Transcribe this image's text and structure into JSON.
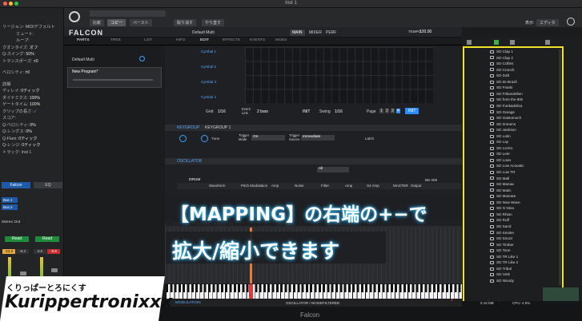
{
  "window": {
    "title": "Inst 1"
  },
  "toolbar": {
    "compare": "比較",
    "copy": "コピー",
    "paste": "ペースト",
    "undo": "取り消す",
    "redo": "やり直す",
    "view": "表示:",
    "view_value": "エディタ"
  },
  "region": {
    "label": "リージョン: MIDIデフォルト",
    "mute": "ミュート:",
    "loop": "ループ:",
    "quantize": "クオンタイズ:",
    "quantize_val": "オフ",
    "qswing": "Q-スイング:",
    "qswing_val": "50%",
    "transpose": "トランスポーズ:",
    "transpose_val": "±0",
    "velocity": "ベロシティ:",
    "velocity_val": "±0",
    "detail": "詳細",
    "delay": "ディレイ:",
    "delay_val": "0ティック",
    "dynamics": "ダイナミクス:",
    "dynamics_val": "100%",
    "gate": "ゲートタイム:",
    "gate_val": "100%",
    "clip": "クリップの長さ:",
    "score": "スコア:",
    "qvel": "Q-ベロシティ:",
    "qvel_val": "0%",
    "qlen": "Q-レングス:",
    "qlen_val": "0%",
    "qflam": "Q-Flam:",
    "qflam_val": "0ティック",
    "qrange": "Q-レンジ:",
    "qrange_val": "0ティック",
    "track": "トラック: Inst 1"
  },
  "mixer": {
    "falcon": "Falcon",
    "eq": "EQ",
    "bus1": "Bus 1",
    "bus2": "Bus 2",
    "stereo_out": "Stereo Out",
    "read": "Read",
    "val1": "-12.2",
    "val2": "-0.3",
    "val3": "0.0",
    "val4": "-0.6"
  },
  "falcon": {
    "logo": "FALCON",
    "preset": "Default Multi",
    "main": "MAIN",
    "mixer": "MIXER",
    "perf": "PERF",
    "tempo_label": "TEMPO",
    "tempo": "120.00",
    "tab_parts": "PARTS",
    "tab_tree": "TREE",
    "tab_list": "LIST",
    "tab_info": "INFO",
    "tab_edit": "EDIT",
    "tab_effects": "EFFECTS",
    "tab_events": "EVENTS",
    "tab_mods": "MODS",
    "part_default": "Default Multi",
    "program": "New Program*",
    "cymbal1": "Cymbal 1",
    "cymbal2": "Cymbal 2",
    "cymbal3": "Cymbal 3",
    "cymbal4": "Cymbal 4",
    "grid": "Grid",
    "grid_val": "1/16",
    "event_link": "Event Link",
    "bars": "2 bars",
    "swing": "Swing",
    "swing_val": "1/16",
    "page": "Page",
    "p1": "1",
    "p2": "2",
    "p3": "3",
    "p4": "4",
    "init": "INIT",
    "keygroup": "KEYGROUP 1",
    "keygroup_label": "KEYGROUP",
    "tune": "Tune",
    "trigger_mode": "Trigger Mode",
    "trigger_val": "On",
    "trigger_source": "Trigger Source",
    "source_val": "Immediate",
    "latch": "Latch",
    "oscillator": "OSCILLATOR",
    "osc_all": "All",
    "drum": "DRUM",
    "waveform": "Waveform",
    "pitch_mod": "Pitch Modulation",
    "amp": "Amp",
    "noise": "Noise",
    "filter": "Filter",
    "amp2": "Amp",
    "s4_amp": "S4 Amp",
    "master": "MASTER",
    "output": "Output",
    "mapping": "MAPPING",
    "root": "Root:",
    "root_val": "C1",
    "key": "Key:",
    "key_val": "C1 · C1",
    "pan": "Pan:",
    "pan_val": "Center",
    "tune2": "Tune:",
    "tune_val": "0 Cents",
    "modulation": "MODULATION",
    "osc_footer": "OSCILLATOR / NOISEFILTERED",
    "footer": "Falcon",
    "mem": "0.16 MB",
    "cpu": "CPU: 4.5%",
    "bd": "BD 009",
    "key_c": "C"
  },
  "browser": {
    "items": [
      "SD Clap 1",
      "SD Clap 2",
      "SD Collins",
      "SD Crunch",
      "SD Daft",
      "SD de Brazil",
      "SD Franki",
      "SD Frikandellen",
      "SD from the 80s",
      "SD Funkadelica",
      "SD Garage",
      "SD Gatsomuch",
      "SD Immens",
      "SD Jankson",
      "SD Latin",
      "SD Lay",
      "SD Lectro",
      "SD Leer",
      "SD Lowx",
      "SD Low Acoustic",
      "SD Low TR",
      "SD Mall",
      "SD Maniac",
      "SD Matic",
      "SD Mosrate",
      "SD New Wave",
      "SD O Nina",
      "SD Rhian",
      "SD Ruff",
      "SD Sand",
      "SD Smoke",
      "SD Snozz",
      "SD Timber",
      "SD Tone",
      "SD TR Like 1",
      "SD TR Like 2",
      "SD Tribal",
      "SD Verb",
      "SD Woody"
    ],
    "folder1": "Sfx Synth",
    "folder2": "FM"
  },
  "overlay": {
    "line1": "【MAPPING】の右端の+−で",
    "line2": "拡大/縮小できます"
  },
  "credit": {
    "kana": "くりっぱーとろにくす",
    "name": "Kurippertronixxx"
  },
  "colors": {
    "highlight": "#f1e22a",
    "accent": "#2d8cff",
    "glow": "#3ac0ff"
  }
}
